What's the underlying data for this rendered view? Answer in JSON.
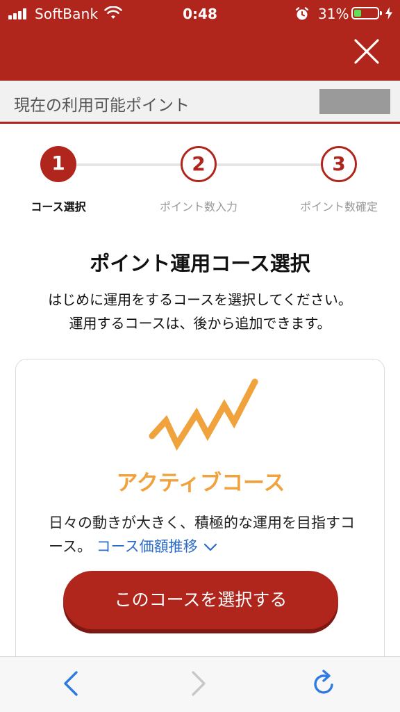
{
  "status_bar": {
    "carrier": "SoftBank",
    "time": "0:48",
    "battery_percent": "31%",
    "battery_level": 0.31,
    "battery_color": "#5ee05a"
  },
  "header": {
    "close_icon": "close-icon",
    "bg_color": "#b0261c"
  },
  "points": {
    "label": "現在の利用可能ポイント"
  },
  "stepper": {
    "current_step": 1,
    "steps": [
      {
        "number": "1",
        "label": "コース選択"
      },
      {
        "number": "2",
        "label": "ポイント数入力"
      },
      {
        "number": "3",
        "label": "ポイント数確定"
      }
    ]
  },
  "main": {
    "title": "ポイント運用コース選択",
    "intro_line1": "はじめに運用をするコースを選択してください。",
    "intro_line2": "運用するコースは、後から追加できます。"
  },
  "course": {
    "icon": "zigzag-chart-icon",
    "name": "アクティブコース",
    "name_color": "#f0a23c",
    "description": "日々の動きが大きく、積極的な運用を目指すコース。",
    "link_label": "コース価額推移",
    "select_button": "このコースを選択する"
  },
  "browser": {
    "back_icon": "chevron-left-icon",
    "forward_icon": "chevron-right-icon",
    "reload_icon": "reload-icon"
  }
}
